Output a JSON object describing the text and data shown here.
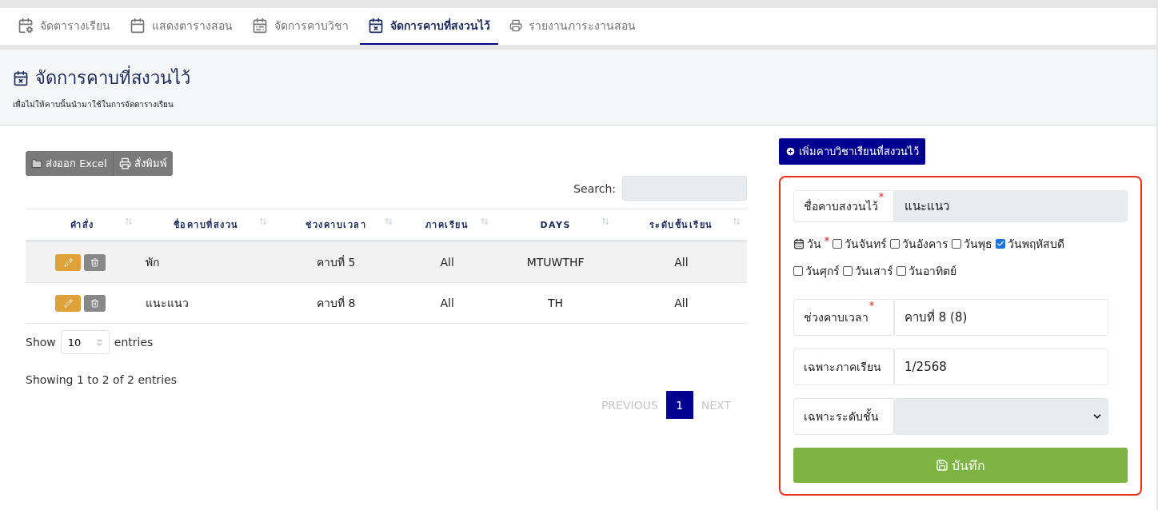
{
  "tabs": [
    {
      "label": "จัดตารางเรียน",
      "selected": false
    },
    {
      "label": "แสดงตารางสอน",
      "selected": false
    },
    {
      "label": "จัดการคาบวิชา",
      "selected": false
    },
    {
      "label": "จัดการคาบที่สงวนไว้",
      "selected": true
    },
    {
      "label": "รายงานภาระงานสอน",
      "selected": false
    }
  ],
  "header": {
    "title": "จัดการคาบที่สงวนไว้",
    "subtitle": "เพื่อไม่ให้คาบนั้นนำมาใช้ในการจัดตารางเรียน"
  },
  "export_buttons": [
    "ส่งออก Excel",
    "สั่งพิมพ์"
  ],
  "search": {
    "label": "Search:"
  },
  "table": {
    "columns": [
      "คำสั่ง",
      "ชื่อคาบที่สงวน",
      "ช่วงคาบเวลา",
      "ภาคเรียน",
      "DAYS",
      "ระดับชั้นเรียน"
    ],
    "rows": [
      {
        "cells": [
          "",
          "พัก",
          "คาบที่ 5",
          "All",
          "MTUWTHF",
          "All"
        ]
      },
      {
        "cells": [
          "",
          "แนะแนว",
          "คาบที่ 8",
          "All",
          "TH",
          "All"
        ]
      }
    ]
  },
  "length": {
    "before": "Show",
    "value": "10",
    "after": "entries"
  },
  "info": "Showing 1 to 2 of 2 entries",
  "pagination": {
    "previous": {
      "label": "PREVIOUS",
      "disabled": true
    },
    "pages": [
      {
        "label": "1",
        "selected": true
      }
    ],
    "next": {
      "label": "NEXT",
      "disabled": true
    }
  },
  "add_button": "เพิ่มคาบวิชาเรียนที่สงวนไว้",
  "form": {
    "name": {
      "label": "ชื่อคาบสงวนไว้",
      "required": true,
      "value": "แนะแนว"
    },
    "days_label": "วัน",
    "days_required": true,
    "days": [
      {
        "label": "วันจันทร์",
        "checked": false
      },
      {
        "label": "วันอังคาร",
        "checked": false
      },
      {
        "label": "วันพุธ",
        "checked": false
      },
      {
        "label": "วันพฤหัสบดี",
        "checked": true
      },
      {
        "label": "วันศุกร์",
        "checked": false
      },
      {
        "label": "วันเสาร์",
        "checked": false
      },
      {
        "label": "วันอาทิตย์",
        "checked": false
      }
    ],
    "period": {
      "label": "ช่วงคาบเวลา",
      "required": true,
      "value": "คาบที่ 8 (8)"
    },
    "term": {
      "label": "เฉพาะภาคเรียน",
      "required": false,
      "value": "1/2568"
    },
    "grade": {
      "label": "เฉพาะระดับชั้น",
      "required": false
    },
    "save": "บันทึก"
  }
}
